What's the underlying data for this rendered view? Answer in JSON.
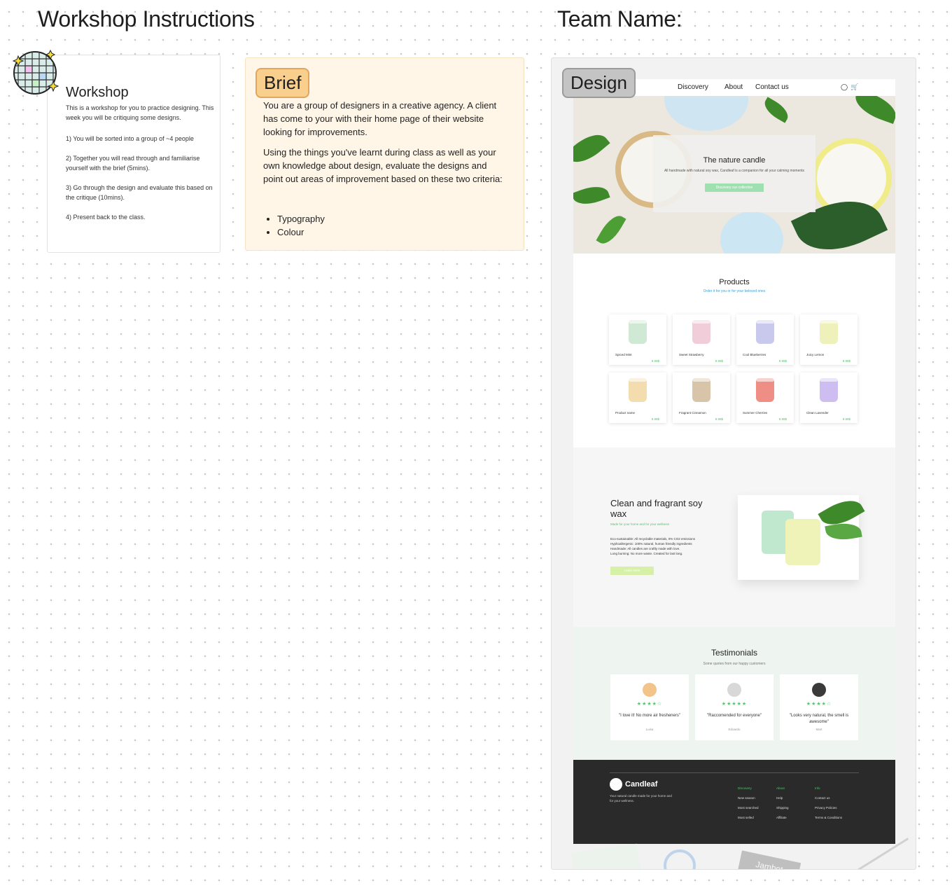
{
  "board": {
    "left_title": "Workshop Instructions",
    "right_title": "Team Name:"
  },
  "workshop": {
    "title": "Workshop",
    "intro": "This is a workshop for you to practice designing. This week you will be critiquing some designs.",
    "steps": [
      "1) You will be sorted into a group of ~4 people",
      "2) Together you will read through and familiarise yourself with the brief (5mins).",
      "3) Go through the design and evaluate this based on the critique (10mins).",
      "4) Present back to the class."
    ]
  },
  "brief": {
    "tag": "Brief",
    "para1": "You are a group of designers in a creative agency. A client has come to your with their home page of their website looking for improvements.",
    "para2": "Using the things you've learnt during class as well as your own knowledge about design, evaluate the designs and point out areas of improvement based on these two criteria:",
    "criteria": [
      "Typography",
      "Colour"
    ]
  },
  "design": {
    "tag": "Design",
    "nav": [
      "Discovery",
      "About",
      "Contact us"
    ],
    "hero": {
      "title": "The nature candle",
      "subtitle": "All handmade with natural soy wax, Candleaf is a companion for all your calming moments",
      "button": "Discovery our collection"
    },
    "products": {
      "title": "Products",
      "subtitle": "Order it for you or for your beloved ones",
      "items": [
        {
          "name": "Spiced Mint",
          "price": "9.99$",
          "color": "#cfe9d4"
        },
        {
          "name": "Sweet Strawberry",
          "price": "9.99$",
          "color": "#f1ccd9"
        },
        {
          "name": "Cool Blueberries",
          "price": "9.99$",
          "color": "#c9c9ee"
        },
        {
          "name": "Juicy Lemon",
          "price": "9.99$",
          "color": "#eef1b9"
        },
        {
          "name": "Product name",
          "price": "9.99$",
          "color": "#f3dcae"
        },
        {
          "name": "Fragrant Cinnamon",
          "price": "9.99$",
          "color": "#d8c4a8"
        },
        {
          "name": "Summer Cherries",
          "price": "9.99$",
          "color": "#ee8e84"
        },
        {
          "name": "Clean Lavender",
          "price": "9.99$",
          "color": "#cdbdf0"
        }
      ]
    },
    "clean": {
      "title": "Clean and fragrant soy wax",
      "subtitle": "Made for your home and for your wellness",
      "items": [
        "Eco-sustainable: All recyclable materials, 0% CO2 emissions",
        "Hyphoallergenic: 100% natural, human friendly ingredients",
        "Handmade: All candles are craftly made with love.",
        "Long burning: No more waste. Created for last long."
      ],
      "button": "Learn more"
    },
    "testimonials": {
      "title": "Testimonials",
      "subtitle": "Some quotes from our happy customers",
      "items": [
        {
          "quote": "\"I love it! No more air fresheners\"",
          "name": "Luisa",
          "stars": "★★★★☆"
        },
        {
          "quote": "\"Raccomended for everyone\"",
          "name": "Edoardo",
          "stars": "★★★★★"
        },
        {
          "quote": "\"Looks very natural, the smell is awesome\"",
          "name": "Mart",
          "stars": "★★★★☆"
        }
      ]
    },
    "footer": {
      "brand": "Candleaf",
      "tagline": "Your natural candle made for your home and for your wellness.",
      "columns": [
        {
          "head": "Discovery",
          "links": [
            "New season",
            "Most searched",
            "Most selled"
          ]
        },
        {
          "head": "About",
          "links": [
            "Help",
            "Shipping",
            "Affiliate"
          ]
        },
        {
          "head": "Info",
          "links": [
            "Contact us",
            "Privacy Policies",
            "Terms & Conditions"
          ]
        }
      ]
    }
  },
  "sticker_text": "Jambot"
}
